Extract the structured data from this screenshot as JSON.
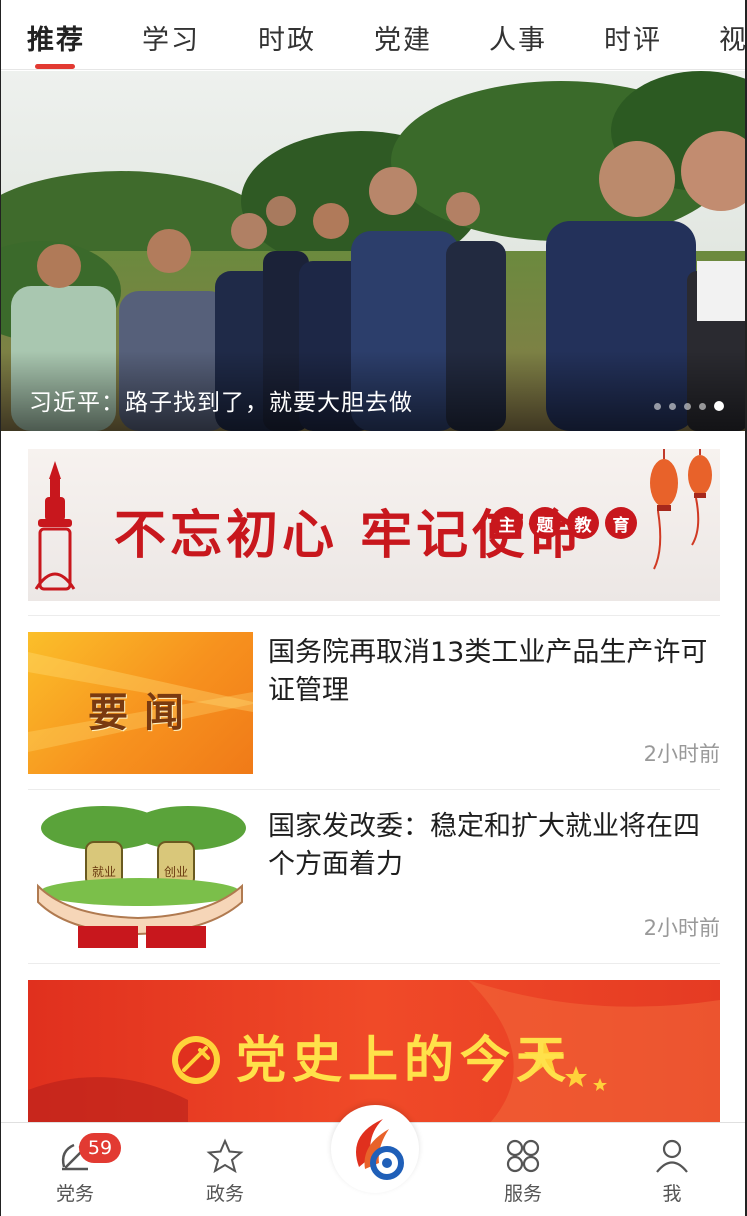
{
  "tabs": [
    {
      "label": "推荐",
      "active": true
    },
    {
      "label": "学习"
    },
    {
      "label": "时政"
    },
    {
      "label": "党建"
    },
    {
      "label": "人事"
    },
    {
      "label": "时评"
    },
    {
      "label": "视"
    }
  ],
  "hero": {
    "caption": "习近平：路子找到了，就要大胆去做",
    "slide_count": 5,
    "active_slide": 5
  },
  "banner_top": {
    "title": "不忘初心 牢记使命",
    "badges": [
      "主",
      "题",
      "教",
      "育"
    ]
  },
  "news": [
    {
      "title": "国务院再取消13类工业产品生产许可证管理",
      "time": "2小时前",
      "thumb_text": "要闻"
    },
    {
      "title": "国家发改委：稳定和扩大就业将在四个方面着力",
      "time": "2小时前",
      "thumb_text_left": "就业",
      "thumb_text_right": "创业"
    }
  ],
  "banner_bottom": {
    "title": "党史上的今天"
  },
  "bottom_nav": {
    "items": [
      {
        "label": "党务",
        "icon": "party-emblem-icon",
        "badge": "59"
      },
      {
        "label": "政务",
        "icon": "star-outline-icon"
      },
      {
        "label": "",
        "icon": "app-logo-icon"
      },
      {
        "label": "服务",
        "icon": "grid-clover-icon"
      },
      {
        "label": "我",
        "icon": "person-icon"
      }
    ]
  },
  "colors": {
    "accent": "#e23a32",
    "banner_red": "#c8171d",
    "caption_white": "#ffffff"
  }
}
